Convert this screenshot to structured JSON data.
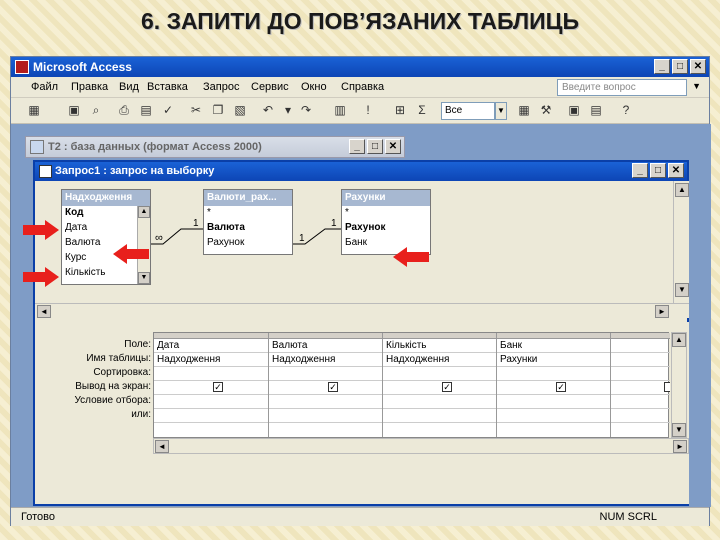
{
  "slide": {
    "title": "6. ЗАПИТИ ДО ПОВ’ЯЗАНИХ ТАБЛИЦЬ"
  },
  "app": {
    "title": "Microsoft Access"
  },
  "menu": [
    "Файл",
    "Правка",
    "Вид",
    "Вставка",
    "Запрос",
    "Сервис",
    "Окно",
    "Справка"
  ],
  "help": {
    "placeholder": "Введите вопрос"
  },
  "toolbar": {
    "top_values": "Все"
  },
  "db_window": {
    "title": "T2 : база данных (формат Access 2000)"
  },
  "query_window": {
    "title": "Запрос1 : запрос на выборку"
  },
  "tables": [
    {
      "name": "Надходження",
      "fields": [
        {
          "name": "Код",
          "key": true
        },
        {
          "name": "Дата"
        },
        {
          "name": "Валюта"
        },
        {
          "name": "Курс"
        },
        {
          "name": "Кількість"
        }
      ]
    },
    {
      "name": "Валюти_рах...",
      "fields": [
        {
          "name": "*"
        },
        {
          "name": "Валюта",
          "key": true
        },
        {
          "name": "Рахунок"
        }
      ]
    },
    {
      "name": "Рахунки",
      "fields": [
        {
          "name": "*"
        },
        {
          "name": "Рахунок",
          "key": true
        },
        {
          "name": "Банк"
        }
      ]
    }
  ],
  "relations": {
    "many_symbol": "∞",
    "one_symbol": "1"
  },
  "grid_labels": [
    "Поле:",
    "Имя таблицы:",
    "Сортировка:",
    "Вывод на экран:",
    "Условие отбора:",
    "или:"
  ],
  "grid_columns": [
    {
      "field": "Дата",
      "table": "Надходження",
      "show": true
    },
    {
      "field": "Валюта",
      "table": "Надходження",
      "show": true
    },
    {
      "field": "Кількість",
      "table": "Надходження",
      "show": true
    },
    {
      "field": "Банк",
      "table": "Рахунки",
      "show": true
    },
    {
      "field": "",
      "table": "",
      "show": false
    }
  ],
  "status": {
    "left": "Готово",
    "right": "NUM  SCRL"
  },
  "colors": {
    "accent_arrow": "#e8201c"
  }
}
